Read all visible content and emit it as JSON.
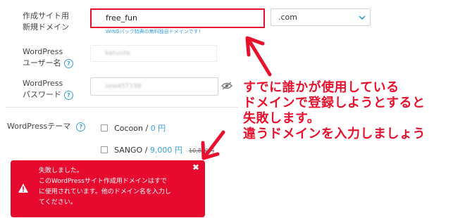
{
  "form": {
    "domain_label": [
      "作成サイト用",
      "新規ドメイン"
    ],
    "domain_value": "free_fun",
    "domain_hint": "WINGパック特典の無料独自ドメインです！",
    "tld_value": ".com",
    "wp_user_label": [
      "WordPress",
      "ユーザー名"
    ],
    "wp_user_value": "katusite",
    "wp_pass_label": [
      "WordPress",
      "パスワード"
    ],
    "wp_pass_value": "sew45T198",
    "theme_label": "WordPressテーマ",
    "themes": [
      {
        "name": "Cocoon",
        "sep": " / ",
        "price": "0 円",
        "old_price": ""
      },
      {
        "name": "SANGO",
        "sep": " / ",
        "price": "9,000 円",
        "old_price": "10,800円"
      }
    ]
  },
  "toast": {
    "title": "失敗しました。",
    "lines": [
      "このWordPressサイト作成用ドメインはすで",
      "に使用されています。他のドメイン名を入力し",
      "てください。"
    ],
    "close": "✖"
  },
  "annotation": {
    "lines": [
      "すでに誰かが使用している",
      "ドメインで登録しようとすると",
      "失敗します。",
      "違うドメインを入力しましょう"
    ]
  },
  "colors": {
    "accent": "#3aa0d8",
    "error": "#e60b2e",
    "annotation": "#e8112d"
  }
}
